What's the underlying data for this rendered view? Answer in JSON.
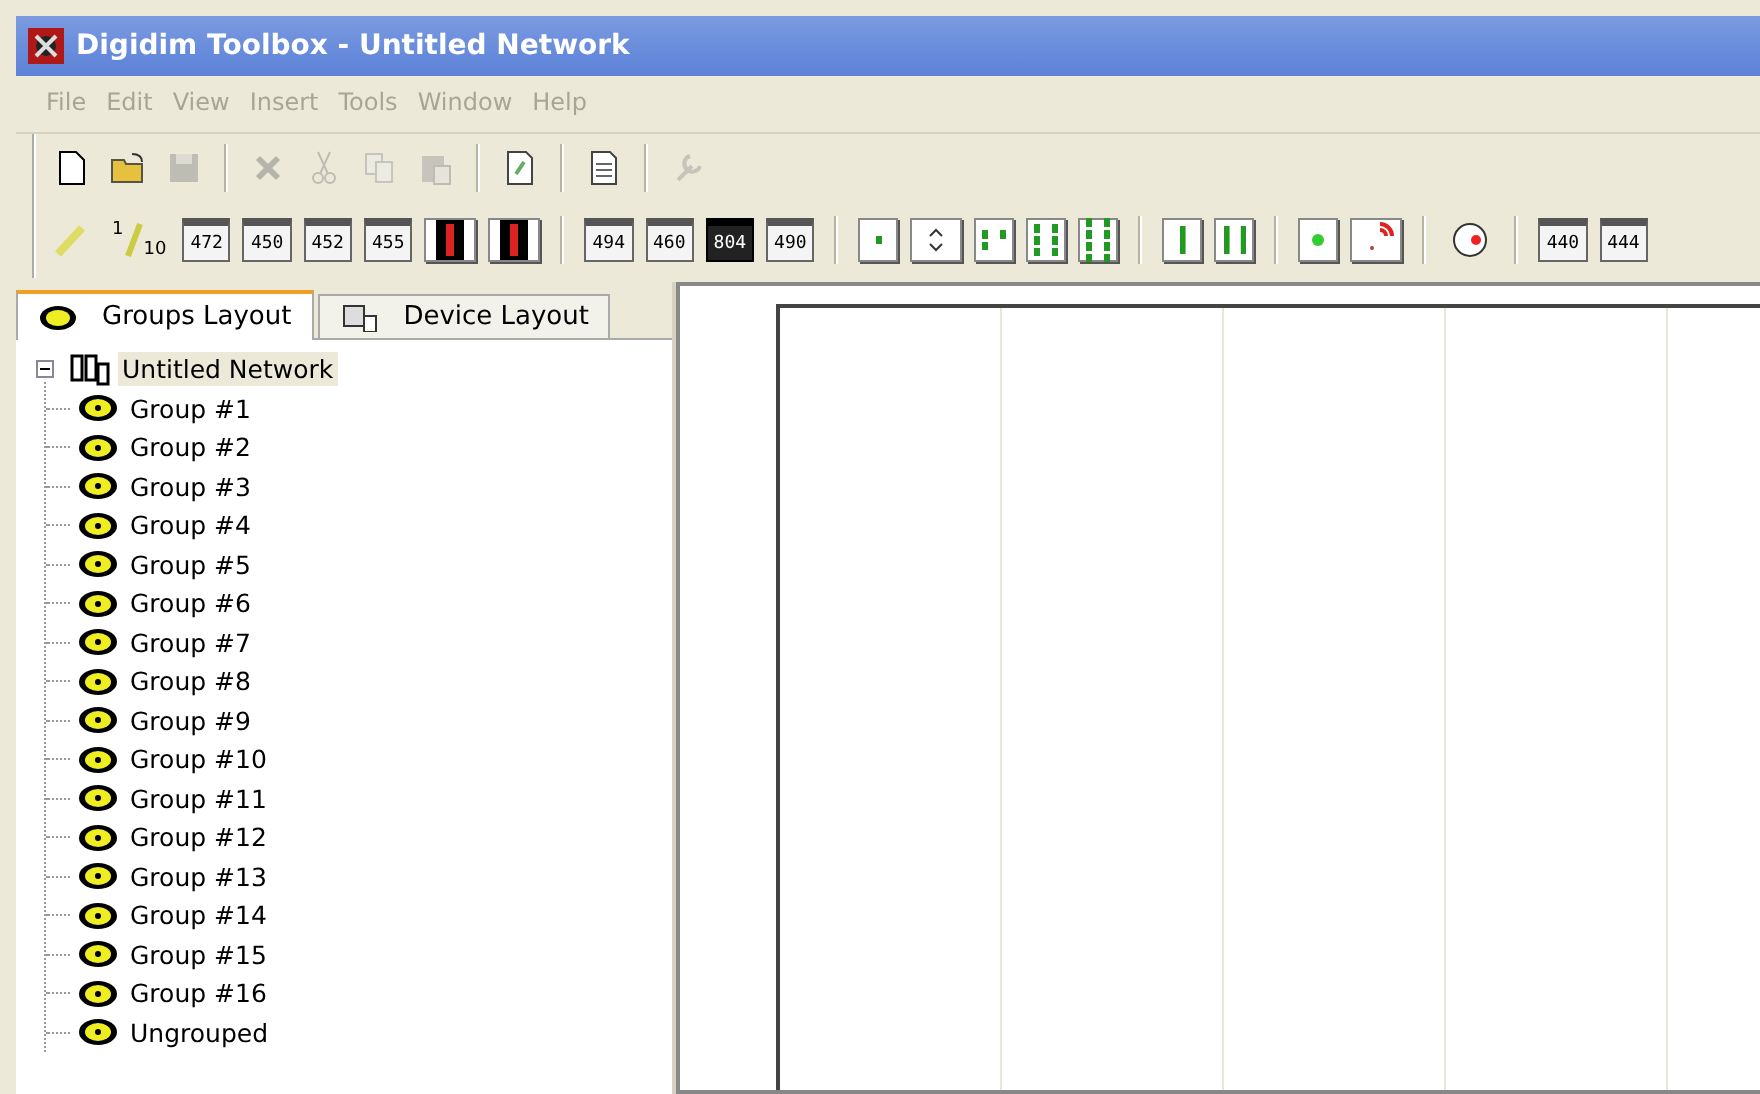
{
  "window": {
    "title": "Digidim Toolbox - Untitled Network"
  },
  "menu": [
    {
      "label": "File",
      "disabled": true
    },
    {
      "label": "Edit",
      "disabled": true
    },
    {
      "label": "View",
      "disabled": true
    },
    {
      "label": "Insert",
      "disabled": true
    },
    {
      "label": "Tools",
      "disabled": true
    },
    {
      "label": "Window",
      "disabled": true
    },
    {
      "label": "Help",
      "disabled": true
    }
  ],
  "toolbar_1": [
    {
      "kind": "new",
      "disabled": false
    },
    {
      "kind": "open",
      "disabled": false
    },
    {
      "kind": "save",
      "disabled": true
    },
    {
      "kind": "sep"
    },
    {
      "kind": "delete",
      "disabled": true
    },
    {
      "kind": "cut",
      "disabled": true
    },
    {
      "kind": "copy",
      "disabled": true
    },
    {
      "kind": "paste",
      "disabled": true
    },
    {
      "kind": "sep"
    },
    {
      "kind": "refresh",
      "disabled": false
    },
    {
      "kind": "sep"
    },
    {
      "kind": "report",
      "disabled": false
    },
    {
      "kind": "sep"
    },
    {
      "kind": "wrench",
      "disabled": true
    }
  ],
  "toolbar_2": [
    {
      "kind": "pen"
    },
    {
      "kind": "scale",
      "label": "1",
      "sub": "10"
    },
    {
      "kind": "module",
      "label": "472"
    },
    {
      "kind": "module",
      "label": "450"
    },
    {
      "kind": "module",
      "label": "452"
    },
    {
      "kind": "module",
      "label": "455"
    },
    {
      "kind": "vertical"
    },
    {
      "kind": "vertical"
    },
    {
      "kind": "sep"
    },
    {
      "kind": "module",
      "label": "494"
    },
    {
      "kind": "module",
      "label": "460"
    },
    {
      "kind": "dark",
      "label": "804"
    },
    {
      "kind": "module",
      "label": "490"
    },
    {
      "kind": "sep"
    },
    {
      "kind": "dots1"
    },
    {
      "kind": "updown"
    },
    {
      "kind": "dots3"
    },
    {
      "kind": "dots6"
    },
    {
      "kind": "dots8"
    },
    {
      "kind": "sep"
    },
    {
      "kind": "bar1"
    },
    {
      "kind": "bar2"
    },
    {
      "kind": "sep"
    },
    {
      "kind": "sensor"
    },
    {
      "kind": "signal"
    },
    {
      "kind": "sep"
    },
    {
      "kind": "round"
    },
    {
      "kind": "sep"
    },
    {
      "kind": "module",
      "label": "440"
    },
    {
      "kind": "module",
      "label": "444"
    }
  ],
  "tabs": [
    {
      "label": "Groups Layout",
      "selected": true
    },
    {
      "label": "Device Layout",
      "selected": false
    }
  ],
  "tree": {
    "label": "Untitled Network",
    "expanded": true,
    "children": [
      {
        "label": "Group #1"
      },
      {
        "label": "Group #2"
      },
      {
        "label": "Group #3"
      },
      {
        "label": "Group #4"
      },
      {
        "label": "Group #5"
      },
      {
        "label": "Group #6"
      },
      {
        "label": "Group #7"
      },
      {
        "label": "Group #8"
      },
      {
        "label": "Group #9"
      },
      {
        "label": "Group #10"
      },
      {
        "label": "Group #11"
      },
      {
        "label": "Group #12"
      },
      {
        "label": "Group #13"
      },
      {
        "label": "Group #14"
      },
      {
        "label": "Group #15"
      },
      {
        "label": "Group #16"
      },
      {
        "label": "Ungrouped"
      }
    ]
  }
}
